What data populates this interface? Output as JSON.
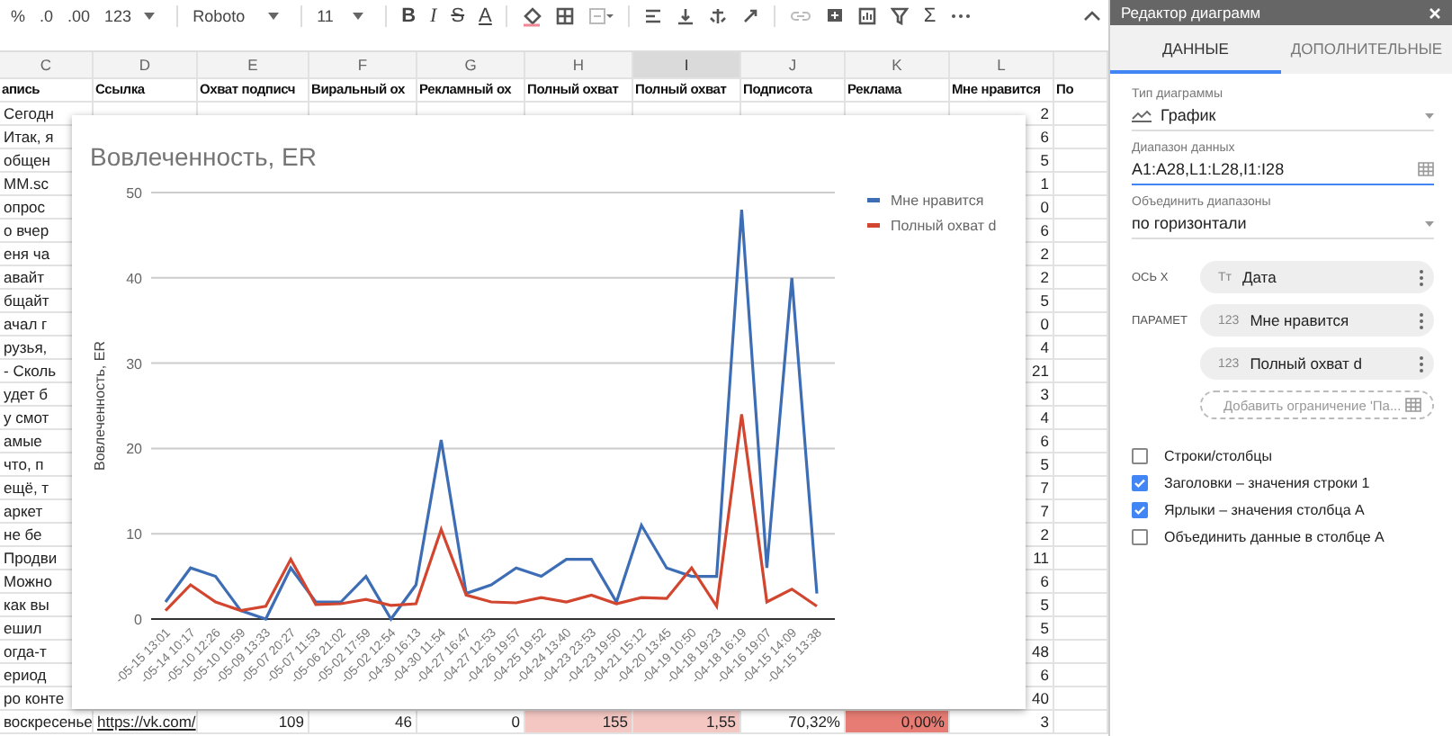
{
  "toolbar": {
    "percent": "%",
    "decrease_decimals": ".0",
    "increase_decimals": ".00",
    "number_format": "123",
    "font": "Roboto",
    "font_size": "11",
    "bold": "B",
    "italic": "I",
    "strikethrough": "S",
    "text_color": "A",
    "sum": "Σ"
  },
  "sheet": {
    "columns": [
      {
        "letter": "C",
        "header": "апись",
        "selected": false
      },
      {
        "letter": "D",
        "header": "Ссылка",
        "selected": false
      },
      {
        "letter": "E",
        "header": "Охват подписч",
        "selected": false
      },
      {
        "letter": "F",
        "header": "Виральный ох",
        "selected": false
      },
      {
        "letter": "G",
        "header": "Рекламный ох",
        "selected": false
      },
      {
        "letter": "H",
        "header": "Полный охват",
        "selected": false
      },
      {
        "letter": "I",
        "header": "Полный охват",
        "selected": true
      },
      {
        "letter": "J",
        "header": "Подписота",
        "selected": false
      },
      {
        "letter": "K",
        "header": "Реклама",
        "selected": false
      },
      {
        "letter": "L",
        "header": "Мне нравится",
        "selected": false
      },
      {
        "header": "По",
        "selected": false
      }
    ],
    "rows": [
      {
        "record": "Сегодн",
        "likes": "2"
      },
      {
        "record": "Итак, я",
        "likes": "6"
      },
      {
        "record": "общен",
        "likes": "5"
      },
      {
        "record": "MM.sc",
        "likes": "1"
      },
      {
        "record": "опрос",
        "likes": "0"
      },
      {
        "record": "о вчер",
        "likes": "6"
      },
      {
        "record": "еня ча",
        "likes": "2"
      },
      {
        "record": "авайт",
        "likes": "2"
      },
      {
        "record": "бщайт",
        "likes": "5"
      },
      {
        "record": "ачал г",
        "likes": "0"
      },
      {
        "record": "рузья,",
        "likes": "4"
      },
      {
        "record": "- Сколь",
        "likes": "21"
      },
      {
        "record": "удет б",
        "likes": "3"
      },
      {
        "record": "у смот",
        "likes": "4"
      },
      {
        "record": "амые",
        "likes": "6"
      },
      {
        "record": "что, п",
        "likes": "5"
      },
      {
        "record": "ещё, т",
        "likes": "7"
      },
      {
        "record": "аркет",
        "likes": "7"
      },
      {
        "record": "не бе",
        "likes": "2"
      },
      {
        "record": "Продви",
        "likes": "11"
      },
      {
        "record": "Можно",
        "likes": "6"
      },
      {
        "record": "как вы",
        "likes": "5"
      },
      {
        "record": "ешил",
        "likes": "5"
      },
      {
        "record": "огда-т",
        "likes": "48"
      },
      {
        "record": "ериод",
        "likes": "6"
      },
      {
        "record": "ро конте",
        "likes": "40"
      }
    ],
    "last_row": {
      "cells": [
        {
          "kind": "text",
          "text": "воскресенье"
        },
        {
          "kind": "link",
          "text": "https://vk.com/"
        },
        {
          "kind": "number",
          "text": "109"
        },
        {
          "kind": "number",
          "text": "46"
        },
        {
          "kind": "number",
          "text": "0"
        },
        {
          "kind": "number",
          "text": "155",
          "color": "#f4c7c3"
        },
        {
          "kind": "number",
          "text": "1,55",
          "color": "#f4c7c3"
        },
        {
          "kind": "number",
          "text": "70,32%"
        },
        {
          "kind": "number",
          "text": "0,00%",
          "color": "#e67c73"
        },
        {
          "kind": "number",
          "text": "3"
        }
      ]
    }
  },
  "chart": {
    "chart_data": {
      "type": "line",
      "title": "Вовлеченность, ER",
      "ylabel": "Вовлеченность, ER",
      "categories": [
        "-05-15 13:01",
        "-05-14 10:17",
        "-05-10 12:26",
        "-05-10 10:59",
        "-05-09 13:33",
        "-05-07 20:27",
        "-05-07 11:53",
        "-05-06 21:02",
        "-05-02 17:59",
        "-05-02 12:54",
        "-04-30 16:13",
        "-04-30 11:54",
        "-04-27 16:47",
        "-04-27 12:53",
        "-04-26 19:57",
        "-04-25 19:52",
        "-04-24 13:40",
        "-04-23 23:53",
        "-04-23 19:50",
        "-04-21 15:12",
        "-04-20 13:45",
        "-04-19 10:50",
        "-04-18 19:23",
        "-04-18 16:19",
        "-04-16 19:07",
        "-04-15 14:09",
        "-04-15 13:38"
      ],
      "series": [
        {
          "name": "Мне нравится",
          "color": "#3d6db5",
          "values": [
            2,
            6,
            5,
            1,
            0,
            6,
            2,
            2,
            5,
            0,
            4,
            21,
            3,
            4,
            6,
            5,
            7,
            7,
            2,
            11,
            6,
            5,
            5,
            48,
            6,
            40,
            3
          ]
        },
        {
          "name": "Полный охват d",
          "color": "#d2452f",
          "values": [
            1,
            4,
            2,
            1,
            1.5,
            7,
            1.7,
            1.8,
            2.3,
            1.6,
            1.8,
            10.5,
            2.8,
            2,
            1.9,
            2.5,
            2,
            2.8,
            1.8,
            2.5,
            2.4,
            6,
            1.5,
            24,
            2,
            3.5,
            1.5
          ]
        }
      ],
      "grid": true,
      "legend": true,
      "ylim": [
        0,
        50
      ],
      "yticks": [
        0,
        10,
        20,
        30,
        40,
        50
      ]
    }
  },
  "chart_editor": {
    "title": "Редактор диаграмм",
    "tabs": [
      {
        "label": "ДАННЫЕ",
        "selected": true
      },
      {
        "label": "ДОПОЛНИТЕЛЬНЫЕ",
        "selected": false
      }
    ],
    "chart_type": {
      "label": "Тип диаграммы",
      "value": "График"
    },
    "data_range": {
      "label": "Диапазон данных",
      "value": "A1:A28,L1:L28,I1:I28"
    },
    "combine_ranges": {
      "label": "Объединить диапазоны",
      "value": "по горизонтали"
    },
    "x_axis": {
      "label": "ОСЬ X",
      "badge": "Tт",
      "value": "Дата"
    },
    "series": {
      "label": "ПАРАМЕТ",
      "chips": [
        {
          "badge": "123",
          "value": "Мне нравится"
        },
        {
          "badge": "123",
          "value": "Полный охват d"
        }
      ],
      "add_placeholder": "Добавить ограничение 'Па..."
    },
    "options": [
      {
        "label": "Строки/столбцы",
        "checked": false
      },
      {
        "label": "Заголовки – значения строки 1",
        "checked": true
      },
      {
        "label": "Ярлыки – значения столбца A",
        "checked": true
      },
      {
        "label": "Объединить данные в столбце A",
        "checked": false
      }
    ]
  }
}
